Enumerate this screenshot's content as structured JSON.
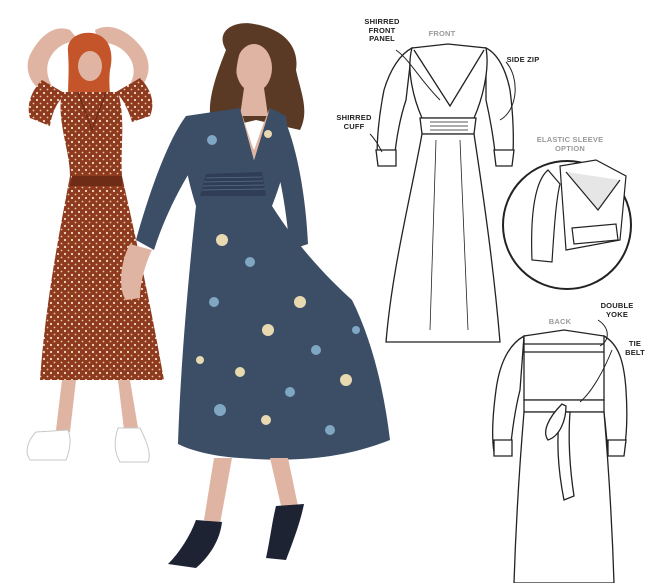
{
  "labels": {
    "shirred_front_panel": "SHIRRED\nFRONT\nPANEL",
    "front": "FRONT",
    "side_zip": "SIDE ZIP",
    "shirred_cuff": "SHIRRED\nCUFF",
    "elastic_sleeve_option": "ELASTIC SLEEVE\nOPTION",
    "back": "BACK",
    "double_yoke": "DOUBLE\nYOKE",
    "tie_belt": "TIE\nBELT"
  },
  "colors": {
    "rust_dress": "#8e3a1f",
    "navy_dress": "#3c4d66",
    "hair_red": "#c4552a",
    "hair_brown": "#5a3a24",
    "skin": "#e0b4a2",
    "shoe": "#1d2333",
    "line_art": "#222222"
  }
}
